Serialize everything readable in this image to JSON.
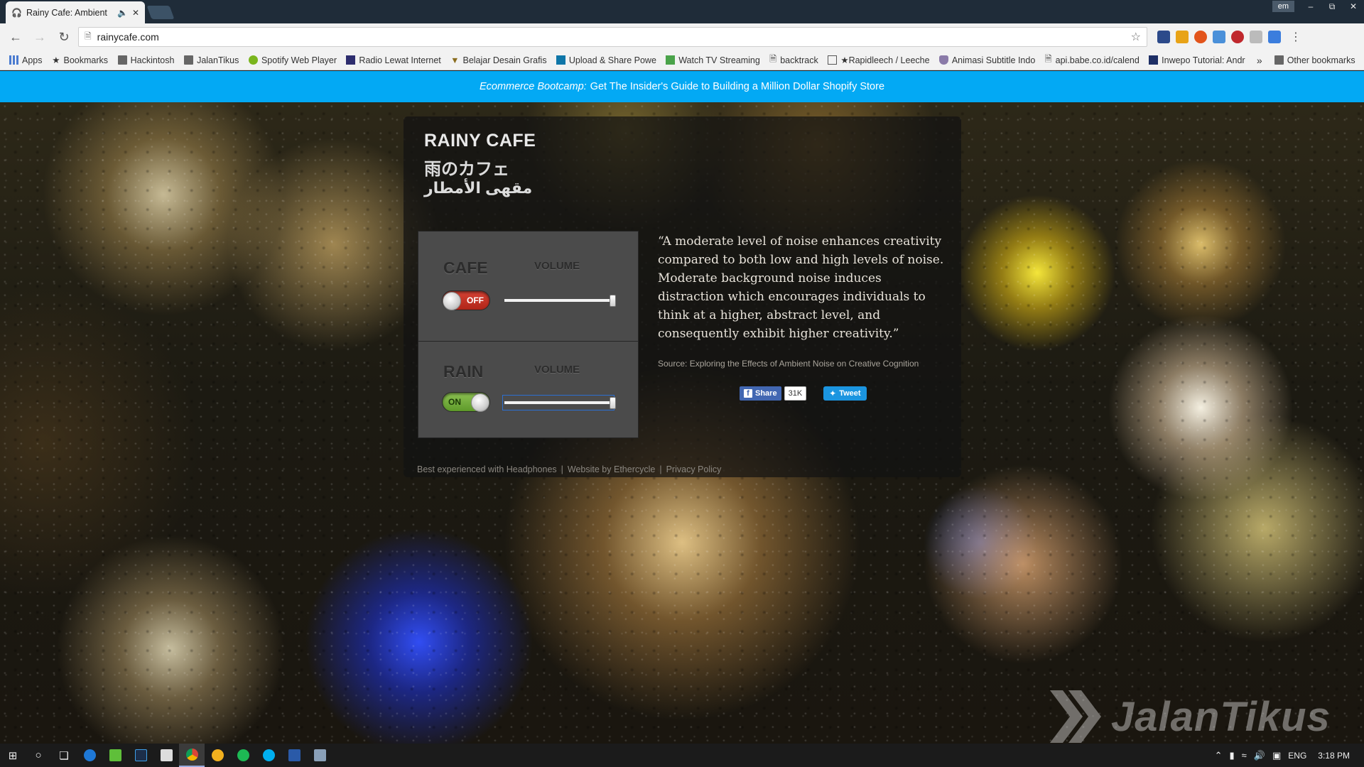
{
  "browser": {
    "tab_title": "Rainy Cafe: Ambient",
    "tab_audio_icon": "speaker-icon",
    "profile_label": "em",
    "url": "rainycafe.com",
    "bookmarks": [
      {
        "label": "Apps",
        "icon": "apps-grid-icon"
      },
      {
        "label": "Bookmarks",
        "icon": "star-icon"
      },
      {
        "label": "Hackintosh",
        "icon": "folder-icon"
      },
      {
        "label": "JalanTikus",
        "icon": "folder-icon"
      },
      {
        "label": "Spotify Web Player",
        "icon": "spotify-icon"
      },
      {
        "label": "Radio Lewat Internet",
        "icon": "radio-icon"
      },
      {
        "label": "Belajar Desain Grafis",
        "icon": "design-icon"
      },
      {
        "label": "Upload & Share Powe",
        "icon": "linkedin-icon"
      },
      {
        "label": "Watch TV Streaming",
        "icon": "tv-icon"
      },
      {
        "label": "backtrack",
        "icon": "page-icon"
      },
      {
        "label": "★Rapidleech / Leeche",
        "icon": "rapidleech-icon"
      },
      {
        "label": "Animasi Subtitle Indo",
        "icon": "shield-icon"
      },
      {
        "label": "api.babe.co.id/calend",
        "icon": "page-icon"
      },
      {
        "label": "Inwepo Tutorial: Andr",
        "icon": "inwepo-icon"
      }
    ],
    "bookmarks_overflow": "»",
    "other_bookmarks": "Other bookmarks"
  },
  "promo": {
    "emphasis": "Ecommerce Bootcamp:",
    "text": "Get The Insider's Guide to Building a Million Dollar Shopify Store"
  },
  "site": {
    "title_en": "RAINY CAFE",
    "title_ja": "雨のカフェ",
    "title_ar": "مقهى الأمطار"
  },
  "controls": [
    {
      "name": "CAFE",
      "volume_label": "VOLUME",
      "toggle_label": "OFF",
      "state": "off",
      "volume": 1.0
    },
    {
      "name": "RAIN",
      "volume_label": "VOLUME",
      "toggle_label": "ON",
      "state": "on",
      "volume": 1.0
    }
  ],
  "quote": {
    "text": "“A moderate level of noise enhances creativity compared to both low and high levels of noise. Moderate background noise induces distraction which encourages individuals to think at a higher, abstract level, and consequently exhibit higher creativity.”",
    "source": "Source: Exploring the Effects of Ambient Noise on Creative Cognition"
  },
  "share": {
    "fb_label": "Share",
    "fb_count": "31K",
    "tweet_label": "Tweet"
  },
  "footer": {
    "links": [
      "Best experienced with Headphones",
      "Website by Ethercycle",
      "Privacy Policy"
    ],
    "separator": "|"
  },
  "watermark": "JalanTikus",
  "taskbar": {
    "tray_lang": "ENG",
    "clock": "3:18 PM"
  },
  "colors": {
    "promo_bg": "#03a9f4",
    "toggle_off": "#c8352a",
    "toggle_on": "#7cb342",
    "fb_blue": "#4267b2",
    "twitter_blue": "#1b95e0"
  }
}
